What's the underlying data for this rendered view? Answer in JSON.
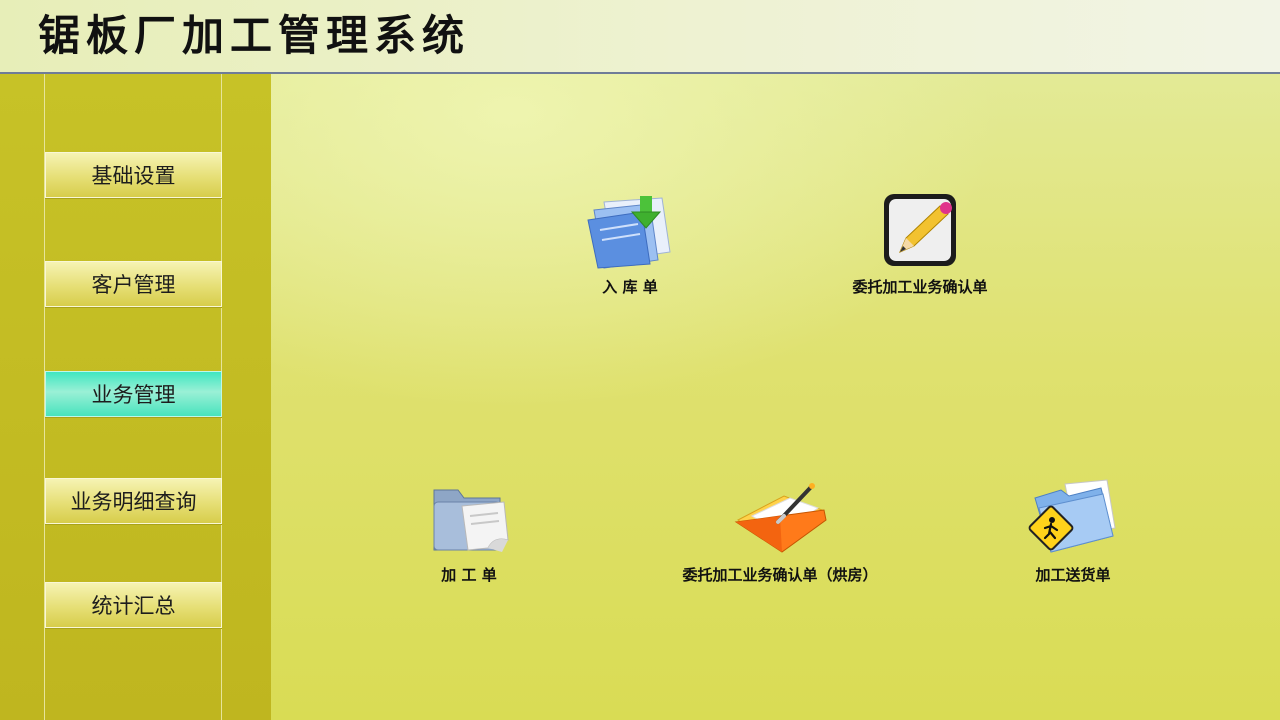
{
  "header": {
    "title": "锯板厂加工管理系统"
  },
  "sidebar": {
    "items": [
      {
        "label": "基础设置",
        "active": false
      },
      {
        "label": "客户管理",
        "active": false
      },
      {
        "label": "业务管理",
        "active": true
      },
      {
        "label": "业务明细查询",
        "active": false
      },
      {
        "label": "统计汇总",
        "active": false
      }
    ]
  },
  "main": {
    "tiles": [
      {
        "label": "入 库 单",
        "icon": "inbound-docs-icon"
      },
      {
        "label": "委托加工业务确认单",
        "icon": "pencil-edit-icon"
      },
      {
        "label": "加 工 单",
        "icon": "folder-paper-icon"
      },
      {
        "label": "委托加工业务确认单（烘房）",
        "icon": "orange-folder-pen-icon"
      },
      {
        "label": "加工送货单",
        "icon": "folder-warning-sign-icon"
      }
    ]
  },
  "colors": {
    "sidebar_bg": "#c4bd24",
    "active_item": "#5ee9c6",
    "main_bg": "#dfe16f"
  }
}
